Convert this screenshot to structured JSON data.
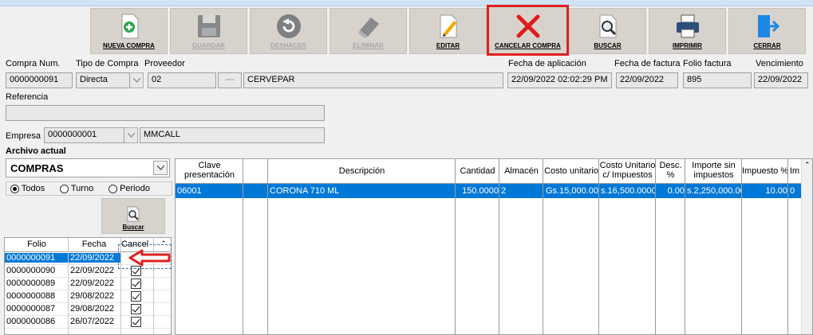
{
  "toolbar": [
    {
      "name": "nueva-compra-button",
      "label": "NUEVA COMPRA",
      "icon": "add-document-icon",
      "enabled": true
    },
    {
      "name": "guardar-button",
      "label": "GUARDAR",
      "icon": "floppy-disk-icon",
      "enabled": false
    },
    {
      "name": "deshacer-button",
      "label": "DESHACER",
      "icon": "undo-icon",
      "enabled": false
    },
    {
      "name": "eliminar-button",
      "label": "ELIMINAR",
      "icon": "eraser-icon",
      "enabled": false
    },
    {
      "name": "editar-button",
      "label": "EDITAR",
      "icon": "edit-pencil-icon",
      "enabled": true
    },
    {
      "name": "cancelar-compra-button",
      "label": "CANCELAR COMPRA",
      "icon": "red-x-icon",
      "enabled": true
    },
    {
      "name": "buscar-button",
      "label": "BUSCAR",
      "icon": "magnifier-icon",
      "enabled": true
    },
    {
      "name": "imprimir-button",
      "label": "IMPRIMIR",
      "icon": "printer-icon",
      "enabled": true
    },
    {
      "name": "cerrar-button",
      "label": "CERRAR",
      "icon": "exit-door-icon",
      "enabled": true
    }
  ],
  "form": {
    "compra_num_label": "Compra Num.",
    "compra_num": "0000000091",
    "tipo_label": "Tipo de Compra",
    "tipo": "Directa",
    "proveedor_label": "Proveedor",
    "proveedor_code": "02",
    "proveedor_btn": "---",
    "proveedor_name": "CERVEPAR",
    "fecha_aplicacion_label": "Fecha de aplicación",
    "fecha_aplicacion": "22/09/2022 02:02:29 PM",
    "fecha_factura_label": "Fecha de factura",
    "fecha_factura": "22/09/2022",
    "folio_factura_label": "Folio factura",
    "folio_factura": "895",
    "vencimiento_label": "Vencimiento",
    "vencimiento": "22/09/2022",
    "referencia_label": "Referencia",
    "referencia": "",
    "empresa_label": "Empresa",
    "empresa_code": "0000000001",
    "empresa_name": "MMCALL"
  },
  "archivo": {
    "label": "Archivo actual",
    "value": "COMPRAS",
    "radios": [
      "Todos",
      "Turno",
      "Periodo"
    ],
    "selected_radio": "Todos",
    "buscar_label": "Buscar"
  },
  "list": {
    "headers": [
      "Folio",
      "Fecha",
      "Cancel"
    ],
    "rows": [
      [
        "0000000091",
        "22/09/2022"
      ],
      [
        "0000000090",
        "22/09/2022"
      ],
      [
        "0000000089",
        "22/09/2022"
      ],
      [
        "0000000088",
        "29/08/2022"
      ],
      [
        "0000000087",
        "29/08/2022"
      ],
      [
        "0000000086",
        "26/07/2022"
      ]
    ]
  },
  "detail": {
    "headers": [
      "Clave\npresentación",
      "",
      "Descripción",
      "Cantidad",
      "Almacén",
      "Costo unitario",
      "Costo Unitario\nc/ Impuestos",
      "Desc.\n%",
      "Importe sin\nimpuestos",
      "Impuesto %",
      "Im"
    ],
    "rows": [
      [
        "06001",
        "",
        "CORONA 710 ML",
        "150.0000",
        "2",
        "Gs.15,000.00",
        "s.16,500.0000",
        "0.00",
        "s.2,250,000.00",
        "10.00",
        "0"
      ]
    ]
  },
  "colors": {
    "selection": "#0078d7",
    "highlight": "#e02020"
  }
}
